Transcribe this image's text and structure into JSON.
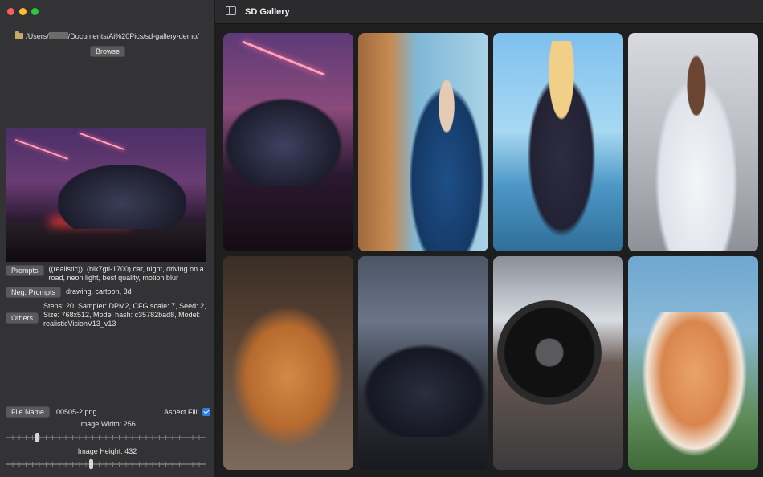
{
  "sidebar": {
    "path_prefix": "/Users/",
    "path_suffix": "/Documents/Ai%20Pics/sd-gallery-demo/",
    "browse_label": "Browse",
    "prompts_label": "Prompts",
    "prompts_text": "((realistic)), (blk7gti-1700) car, night, driving on a road, neon light, best quality, motion blur",
    "neg_prompts_label": "Neg. Prompts",
    "neg_prompts_text": "drawing, cartoon, 3d",
    "others_label": "Others",
    "others_text": "Steps: 20, Sampler: DPM2, CFG scale: 7, Seed: 2, Size: 768x512, Model hash: c35782bad8, Model: realisticVisionV13_v13",
    "file_name_label": "File Name",
    "file_name_value": "00505-2.png",
    "aspect_fill_label": "Aspect Fill:",
    "aspect_fill_checked": true,
    "image_width_label": "Image Width: 256",
    "image_width_value": 256,
    "image_height_label": "Image Height: 432",
    "image_height_value": 432
  },
  "header": {
    "title": "SD Gallery"
  },
  "colors": {
    "accent": "#2f7de1",
    "close": "#ff5f57",
    "minimize": "#febc2e",
    "zoom": "#28c840"
  },
  "gallery": {
    "images": [
      "car-neon-night",
      "old-man-blue-jacket",
      "anime-girl-beach",
      "woman-white-dress",
      "orange-kitten",
      "car-dark-road",
      "car-wheel-closeup",
      "kitten-garden"
    ]
  }
}
